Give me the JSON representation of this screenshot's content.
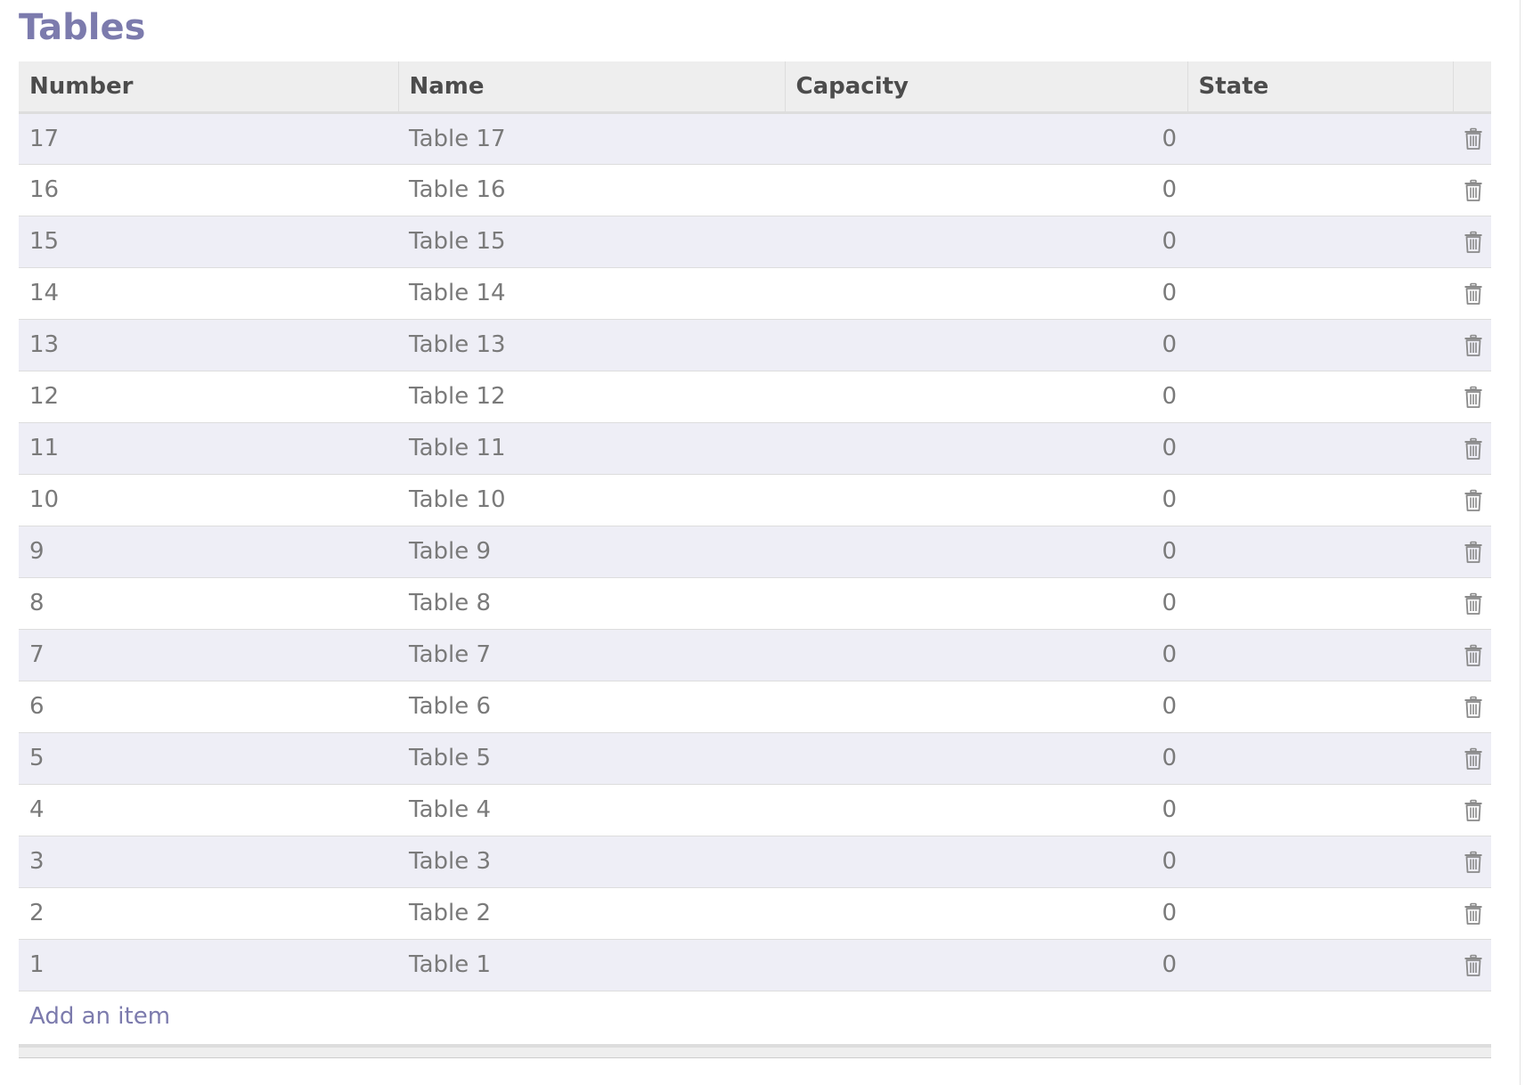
{
  "title": "Tables",
  "columns": [
    "Number",
    "Name",
    "Capacity",
    "State",
    ""
  ],
  "rows": [
    {
      "number": "17",
      "name": "Table 17",
      "capacity": "0",
      "state": ""
    },
    {
      "number": "16",
      "name": "Table 16",
      "capacity": "0",
      "state": ""
    },
    {
      "number": "15",
      "name": "Table 15",
      "capacity": "0",
      "state": ""
    },
    {
      "number": "14",
      "name": "Table 14",
      "capacity": "0",
      "state": ""
    },
    {
      "number": "13",
      "name": "Table 13",
      "capacity": "0",
      "state": ""
    },
    {
      "number": "12",
      "name": "Table 12",
      "capacity": "0",
      "state": ""
    },
    {
      "number": "11",
      "name": "Table 11",
      "capacity": "0",
      "state": ""
    },
    {
      "number": "10",
      "name": "Table 10",
      "capacity": "0",
      "state": ""
    },
    {
      "number": "9",
      "name": "Table 9",
      "capacity": "0",
      "state": ""
    },
    {
      "number": "8",
      "name": "Table 8",
      "capacity": "0",
      "state": ""
    },
    {
      "number": "7",
      "name": "Table 7",
      "capacity": "0",
      "state": ""
    },
    {
      "number": "6",
      "name": "Table 6",
      "capacity": "0",
      "state": ""
    },
    {
      "number": "5",
      "name": "Table 5",
      "capacity": "0",
      "state": ""
    },
    {
      "number": "4",
      "name": "Table 4",
      "capacity": "0",
      "state": ""
    },
    {
      "number": "3",
      "name": "Table 3",
      "capacity": "0",
      "state": ""
    },
    {
      "number": "2",
      "name": "Table 2",
      "capacity": "0",
      "state": ""
    },
    {
      "number": "1",
      "name": "Table 1",
      "capacity": "0",
      "state": ""
    }
  ],
  "row_action_icon": "trash-icon",
  "add_item_label": "Add an item",
  "colors": {
    "title": "#7c7bad",
    "link": "#7c7bad",
    "row_stripe": "#eeeef6",
    "header_bg": "#eeeeee"
  }
}
